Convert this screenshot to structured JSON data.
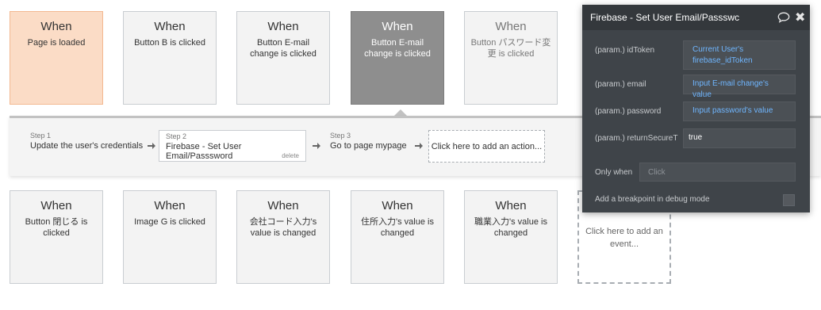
{
  "events_top": [
    {
      "when": "When",
      "desc": "Page is loaded"
    },
    {
      "when": "When",
      "desc": "Button B is clicked"
    },
    {
      "when": "When",
      "desc": "Button E-mail change is clicked"
    },
    {
      "when": "When",
      "desc": "Button E-mail change is clicked"
    },
    {
      "when": "When",
      "desc": "Button パスワード変更 is clicked"
    }
  ],
  "events_bottom": [
    {
      "when": "When",
      "desc": "Button 閉じる is clicked"
    },
    {
      "when": "When",
      "desc": "Image G is clicked"
    },
    {
      "when": "When",
      "desc": "会社コード入力's value is changed"
    },
    {
      "when": "When",
      "desc": "住所入力's value is changed"
    },
    {
      "when": "When",
      "desc": "職業入力's value is changed"
    }
  ],
  "add_event": "Click here to add an event...",
  "workflow": {
    "steps": [
      {
        "num": "Step 1",
        "name": "Update the user's credentials"
      },
      {
        "num": "Step 2",
        "name": "Firebase - Set User Email/Passsword",
        "delete": "delete"
      },
      {
        "num": "Step 3",
        "name": "Go to page mypage"
      }
    ],
    "add_action": "Click here to add an action..."
  },
  "panel": {
    "title": "Firebase - Set User Email/Passswc",
    "params": [
      {
        "label": "(param.) idToken",
        "value": "Current User's firebase_idToken"
      },
      {
        "label": "(param.) email",
        "value": "Input E-mail change's value"
      },
      {
        "label": "(param.) password",
        "value": "Input password's value"
      },
      {
        "label": "(param.) returnSecureT",
        "value": "true"
      }
    ],
    "only_when_label": "Only when",
    "only_when_placeholder": "Click",
    "breakpoint_label": "Add a breakpoint in debug mode",
    "icons": [
      "comment-icon",
      "close-icon"
    ]
  },
  "colors": {
    "page_loaded_bg": "#fbdcc6",
    "selected_bg": "#8e8e8e",
    "panel_bg": "#3f4449",
    "dynamic_link": "#6fb6ff"
  }
}
